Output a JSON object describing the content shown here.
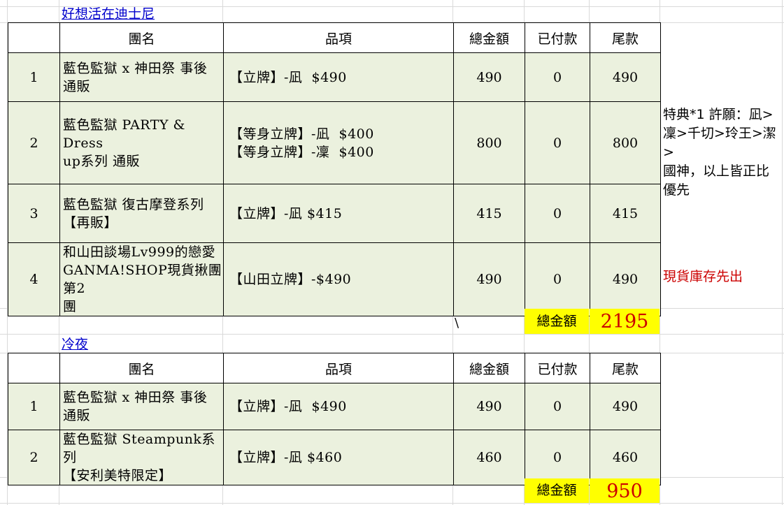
{
  "group1": {
    "title": "好想活在迪士尼",
    "headers": [
      "團名",
      "品項",
      "總金額",
      "已付款",
      "尾款"
    ],
    "rows": [
      {
        "no": "1",
        "name": [
          "藍色監獄 x 神田祭 事後",
          "通販"
        ],
        "items": [
          "【立牌】-凪  $490"
        ],
        "total": "490",
        "paid": "0",
        "balance": "490"
      },
      {
        "no": "2",
        "name": [
          "藍色監獄 PARTY & Dress",
          "up系列 通販"
        ],
        "items": [
          "【等身立牌】-凪  $400",
          "【等身立牌】-凜  $400"
        ],
        "total": "800",
        "paid": "0",
        "balance": "800"
      },
      {
        "no": "3",
        "name": [
          "藍色監獄 復古摩登系列",
          "【再販】"
        ],
        "items": [
          "【立牌】-凪 $415"
        ],
        "total": "415",
        "paid": "0",
        "balance": "415"
      },
      {
        "no": "4",
        "name": [
          "和山田談場Lv999的戀愛",
          "GANMA!SHOP現貨揪團 第2",
          "團"
        ],
        "items": [
          "【山田立牌】-$490"
        ],
        "total": "490",
        "paid": "0",
        "balance": "490"
      }
    ],
    "sum_label": "總金額",
    "sum_value": "2195",
    "note_row2": [
      "特典*1 許願：凪>",
      "凜>千切>玲王>潔>",
      "國神，以上皆正比",
      "優先"
    ],
    "note_row4": "現貨庫存先出",
    "stray_char": "\\"
  },
  "group2": {
    "title": "冷夜",
    "headers": [
      "團名",
      "品項",
      "總金額",
      "已付款",
      "尾款"
    ],
    "rows": [
      {
        "no": "1",
        "name": [
          "藍色監獄 x 神田祭 事後",
          "通販"
        ],
        "items": [
          "【立牌】-凪  $490"
        ],
        "total": "490",
        "paid": "0",
        "balance": "490"
      },
      {
        "no": "2",
        "name": [
          "藍色監獄 Steampunk系列",
          "【安利美特限定】"
        ],
        "items": [
          "【立牌】-凪 $460"
        ],
        "total": "460",
        "paid": "0",
        "balance": "460"
      }
    ],
    "sum_label": "總金額",
    "sum_value": "950"
  },
  "colors": {
    "row_fill": "#ebf1de",
    "total_fill": "#ffff00",
    "total_value": "#cc0000",
    "note_red": "#cc0000",
    "link_blue": "#0000cc"
  }
}
